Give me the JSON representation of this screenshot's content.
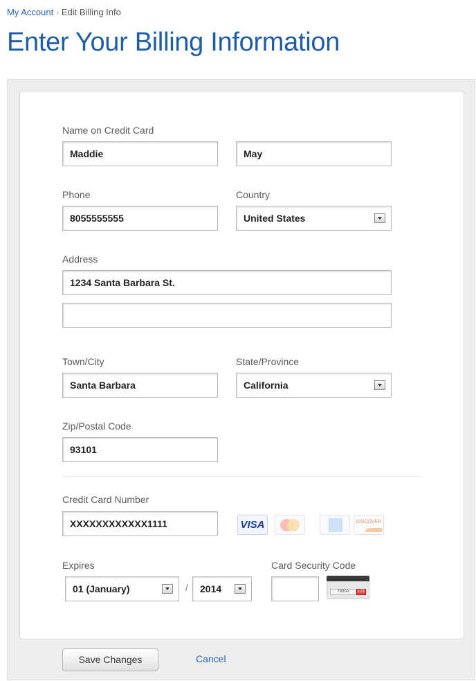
{
  "breadcrumb": {
    "root": "My Account",
    "separator": "›",
    "current": "Edit Billing Info"
  },
  "page_title": "Enter Your Billing Information",
  "form": {
    "name_label": "Name on Credit Card",
    "first_name": "Maddie",
    "last_name": "May",
    "phone_label": "Phone",
    "phone": "8055555555",
    "country_label": "Country",
    "country": "United States",
    "address_label": "Address",
    "address_line1": "1234 Santa Barbara St.",
    "address_line2": "",
    "city_label": "Town/City",
    "city": "Santa Barbara",
    "state_label": "State/Province",
    "state": "California",
    "zip_label": "Zip/Postal Code",
    "zip": "93101",
    "card_number_label": "Credit Card Number",
    "card_number": "XXXXXXXXXXXX1111",
    "card_types": [
      "VISA",
      "mastercard",
      "amex",
      "DISCOVER"
    ],
    "expires_label": "Expires",
    "expires_month": "01 (January)",
    "expires_separator": "/",
    "expires_year": "2014",
    "cvv_label": "Card Security Code",
    "cvv": "",
    "cvv_image": {
      "strip_text": "7890A",
      "code_text": "123"
    }
  },
  "actions": {
    "save_label": "Save Changes",
    "cancel_label": "Cancel"
  },
  "colors": {
    "link": "#2a64b4",
    "title": "#1f5da6"
  }
}
